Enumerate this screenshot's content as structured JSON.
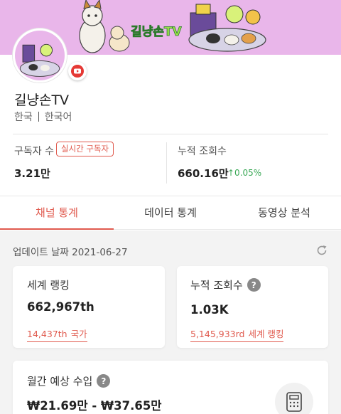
{
  "channel": {
    "name": "길냥손TV",
    "country": "한국",
    "language": "한국어",
    "banner_text": "길냥손TV",
    "platform_icon": "youtube-icon",
    "accent_color": "#e05a4e",
    "banner_color": "#e9b6ea"
  },
  "stats": {
    "subscribers_label": "구독자 수",
    "realtime_label": "실시간 구독자",
    "subscribers_value": "3.21만",
    "views_label": "누적 조회수",
    "views_value": "660.16만",
    "views_growth": "↑0.05%"
  },
  "tabs": [
    {
      "label": "채널 통계",
      "active": true
    },
    {
      "label": "데이터 통계",
      "active": false
    },
    {
      "label": "동영상 분석",
      "active": false
    }
  ],
  "updated": "업데이트 날짜 2021-06-27",
  "cards": {
    "ranking": {
      "title": "세계 랭킹",
      "value": "662,967th",
      "sub_value": "14,437th",
      "sub_label": "국가"
    },
    "views": {
      "title": "누적 조회수",
      "value": "1.03K",
      "sub_value": "5,145,933rd",
      "sub_label": "세계 랭킹"
    },
    "income": {
      "title": "월간 예상 수입",
      "value": "₩21.69만 - ₩37.65만"
    }
  }
}
